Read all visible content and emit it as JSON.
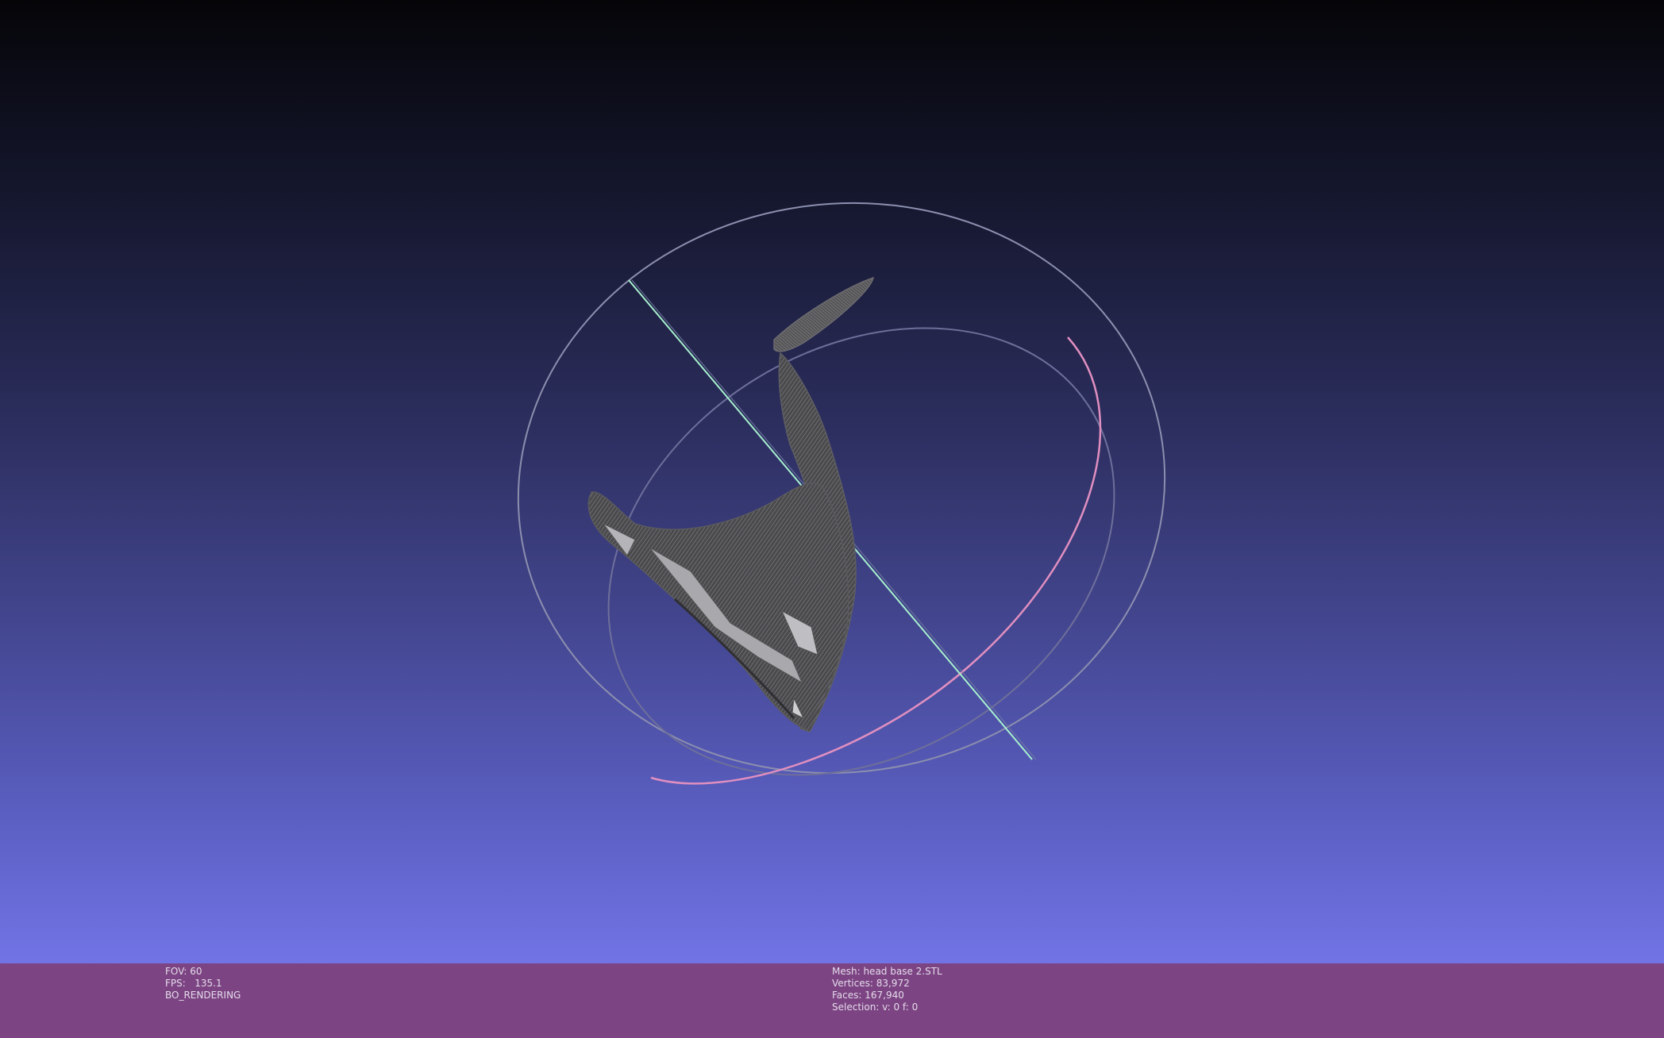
{
  "colors": {
    "info_bar_background": "#7c4483",
    "info_text": "#e4dcea",
    "trackball_ring_grey": "#8c8fae",
    "trackball_ring_pink": "#e08fc0",
    "trackball_axis_green": "#a7f0cf",
    "mesh_fill": "#4f4f52",
    "mesh_wire": "#8b8b8e",
    "background_top": "#050508",
    "background_bottom": "#7476ea"
  },
  "viewport": {
    "object": "mesh-wireframe",
    "widget": "trackball"
  },
  "info_left": {
    "fov": "FOV: 60",
    "fps": "FPS:   135.1",
    "mode": "BO_RENDERING"
  },
  "info_right": {
    "mesh": "Mesh: head base 2.STL",
    "vertices": "Vertices: 83,972",
    "faces": "Faces: 167,940",
    "selection": "Selection: v: 0 f: 0"
  }
}
